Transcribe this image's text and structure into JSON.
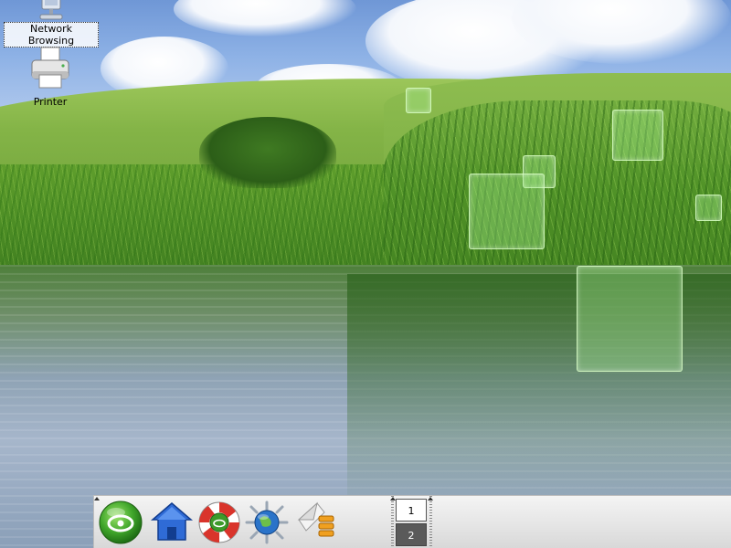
{
  "desktop": {
    "icons": [
      {
        "label": "Network Browsing",
        "icon": "network-browsing-icon",
        "selected": true
      },
      {
        "label": "Printer",
        "icon": "printer-icon",
        "selected": false
      }
    ]
  },
  "panel": {
    "launchers": [
      {
        "name": "kmenu-button",
        "icon": "opensuse-gecko-icon"
      },
      {
        "name": "home-folder-launcher",
        "icon": "home-icon"
      },
      {
        "name": "help-launcher",
        "icon": "lifebuoy-help-icon"
      },
      {
        "name": "konqueror-launcher",
        "icon": "konqueror-globe-icon"
      },
      {
        "name": "kontact-launcher",
        "icon": "mail-envelope-icon"
      }
    ],
    "pager": {
      "desktops": [
        "1",
        "2"
      ],
      "active_desktop": "2"
    }
  },
  "colors": {
    "panel_bg": "#e4e4e4",
    "pager_active": "#5a5a5a",
    "pager_inactive": "#ffffff"
  }
}
